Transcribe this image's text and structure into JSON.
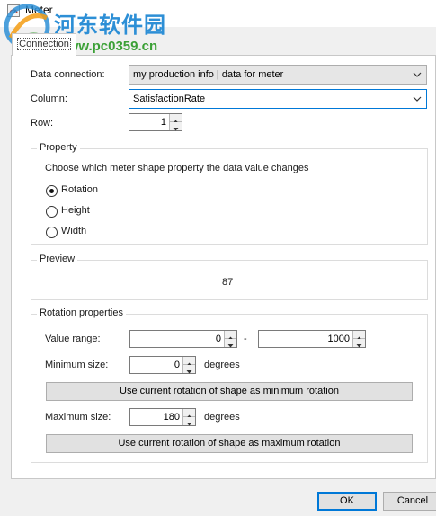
{
  "window": {
    "title": "Meter",
    "icon": "meter-icon"
  },
  "watermark": {
    "site_name": "河东软件园",
    "url": "www.pc0359.cn",
    "logo": "watermark-logo"
  },
  "tabs": [
    {
      "label": "Connection",
      "selected": true
    }
  ],
  "connection": {
    "data_connection_label": "Data connection:",
    "data_connection_value": "my production info | data for meter",
    "column_label": "Column:",
    "column_value": "SatisfactionRate",
    "row_label": "Row:",
    "row_value": "1"
  },
  "property": {
    "title": "Property",
    "description": "Choose which meter shape property the data value changes",
    "options": [
      {
        "label": "Rotation",
        "selected": true
      },
      {
        "label": "Height",
        "selected": false
      },
      {
        "label": "Width",
        "selected": false
      }
    ]
  },
  "preview": {
    "title": "Preview",
    "value": "87"
  },
  "rotation": {
    "title": "Rotation properties",
    "value_range_label": "Value range:",
    "range_min": "0",
    "range_separator": "-",
    "range_max": "1000",
    "min_size_label": "Minimum size:",
    "min_size_value": "0",
    "min_units": "degrees",
    "use_min_button": "Use current rotation of shape as minimum rotation",
    "max_size_label": "Maximum size:",
    "max_size_value": "180",
    "max_units": "degrees",
    "use_max_button": "Use current rotation of shape as maximum rotation"
  },
  "footer": {
    "ok_label": "OK",
    "cancel_label": "Cancel"
  },
  "colors": {
    "focus_accent": "#0078d7",
    "watermark_blue": "#2d8fd6",
    "watermark_green": "#3aa035"
  }
}
